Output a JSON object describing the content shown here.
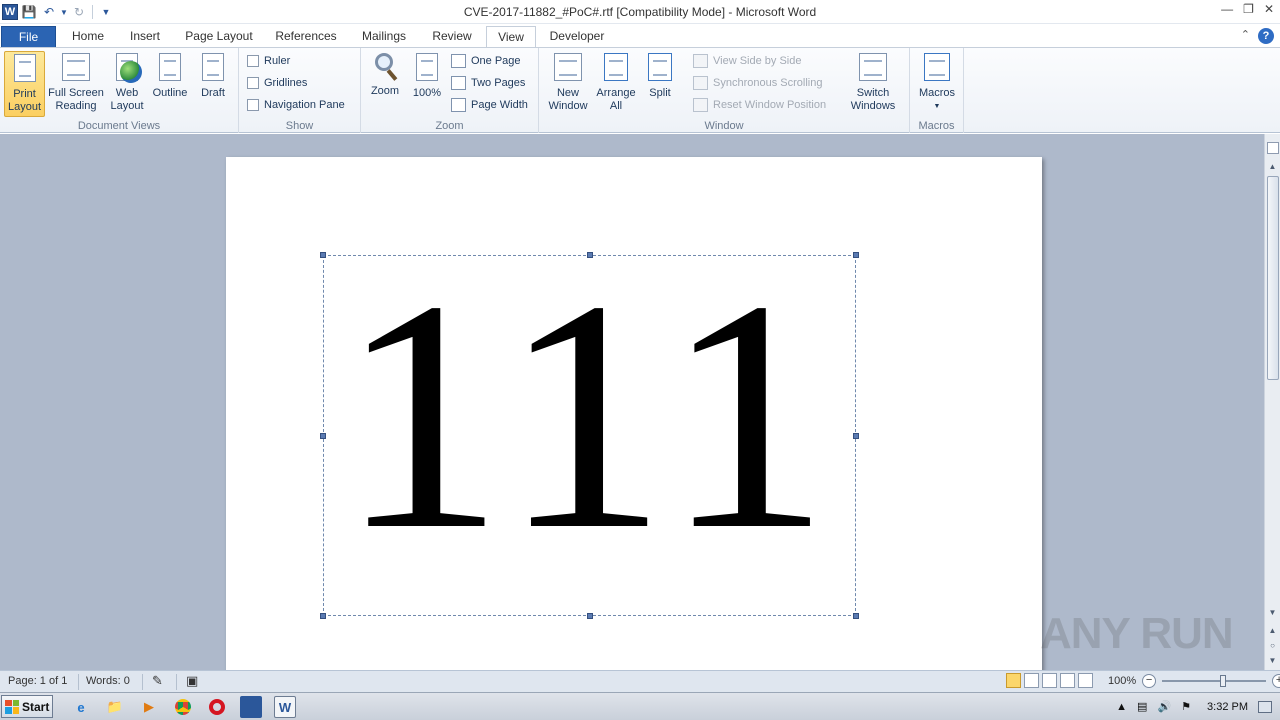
{
  "window": {
    "title": "CVE-2017-11882_#PoC#.rtf [Compatibility Mode]  -  Microsoft Word",
    "app_logo": "W",
    "controls": [
      "minimize-icon",
      "restore-icon",
      "close-icon"
    ]
  },
  "tabs": [
    {
      "label": "File",
      "active": false
    },
    {
      "label": "Home",
      "active": false
    },
    {
      "label": "Insert",
      "active": false
    },
    {
      "label": "Page Layout",
      "active": false
    },
    {
      "label": "References",
      "active": false
    },
    {
      "label": "Mailings",
      "active": false
    },
    {
      "label": "Review",
      "active": false
    },
    {
      "label": "View",
      "active": true
    },
    {
      "label": "Developer",
      "active": false
    }
  ],
  "ribbon": {
    "document_views": {
      "label": "Document Views",
      "print_layout": "Print\nLayout",
      "full_screen": "Full Screen\nReading",
      "web_layout": "Web\nLayout",
      "outline": "Outline",
      "draft": "Draft"
    },
    "show": {
      "label": "Show",
      "ruler": "Ruler",
      "gridlines": "Gridlines",
      "navigation_pane": "Navigation Pane"
    },
    "zoom": {
      "label": "Zoom",
      "zoom": "Zoom",
      "hundred": "100%",
      "one_page": "One Page",
      "two_pages": "Two Pages",
      "page_width": "Page Width"
    },
    "window": {
      "label": "Window",
      "new_window": "New\nWindow",
      "arrange_all": "Arrange\nAll",
      "split": "Split",
      "view_side_by_side": "View Side by Side",
      "synchronous_scrolling": "Synchronous Scrolling",
      "reset_window_position": "Reset Window Position",
      "switch_windows": "Switch\nWindows"
    },
    "macros": {
      "label": "Macros",
      "macros": "Macros"
    }
  },
  "document": {
    "content": "111"
  },
  "watermark": "ANY RUN",
  "status": {
    "page": "Page: 1 of 1",
    "words": "Words: 0",
    "zoom": "100%"
  },
  "taskbar": {
    "start": "Start",
    "time": "3:32 PM"
  },
  "colors": {
    "file_tab": "#2b64b3",
    "active_button": "#fbcf61",
    "workspace": "#aeb9cb"
  }
}
